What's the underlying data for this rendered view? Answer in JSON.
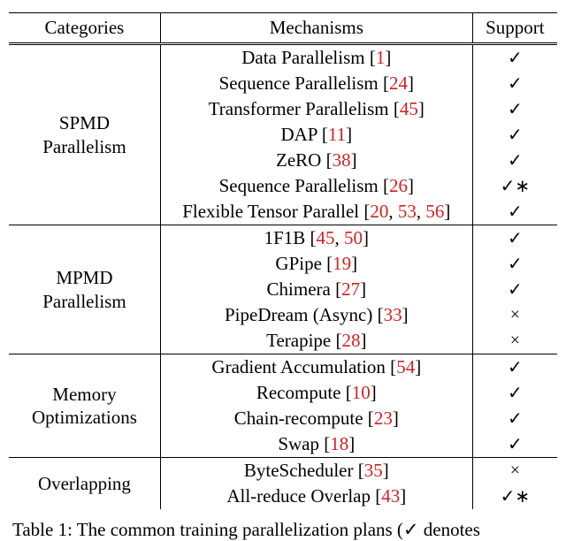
{
  "headers": {
    "c1": "Categories",
    "c2": "Mechanisms",
    "c3": "Support"
  },
  "categories": [
    {
      "name_l1": "SPMD",
      "name_l2": "Parallelism",
      "rows": 7
    },
    {
      "name_l1": "MPMD",
      "name_l2": "Parallelism",
      "rows": 5
    },
    {
      "name_l1": "Memory",
      "name_l2": "Optimizations",
      "rows": 4
    },
    {
      "name_l1": "Overlapping",
      "name_l2": "",
      "rows": 2
    }
  ],
  "rows": [
    {
      "cat": 0,
      "m": "Data Parallelism",
      "refs": [
        "1"
      ],
      "s": "✓"
    },
    {
      "cat": 0,
      "m": "Sequence Parallelism",
      "refs": [
        "24"
      ],
      "s": "✓"
    },
    {
      "cat": 0,
      "m": "Transformer Parallelism",
      "refs": [
        "45"
      ],
      "s": "✓"
    },
    {
      "cat": 0,
      "m": "DAP",
      "refs": [
        "11"
      ],
      "s": "✓"
    },
    {
      "cat": 0,
      "m": "ZeRO",
      "refs": [
        "38"
      ],
      "s": "✓"
    },
    {
      "cat": 0,
      "m": "Sequence Parallelism",
      "refs": [
        "26"
      ],
      "s": "✓∗"
    },
    {
      "cat": 0,
      "m": "Flexible Tensor Parallel",
      "refs": [
        "20",
        "53",
        "56"
      ],
      "s": "✓"
    },
    {
      "cat": 1,
      "m": "1F1B",
      "refs": [
        "45",
        "50"
      ],
      "s": "✓"
    },
    {
      "cat": 1,
      "m": "GPipe",
      "refs": [
        "19"
      ],
      "s": "✓"
    },
    {
      "cat": 1,
      "m": "Chimera",
      "refs": [
        "27"
      ],
      "s": "✓"
    },
    {
      "cat": 1,
      "m": "PipeDream (Async)",
      "refs": [
        "33"
      ],
      "s": "×"
    },
    {
      "cat": 1,
      "m": "Terapipe",
      "refs": [
        "28"
      ],
      "s": "×"
    },
    {
      "cat": 2,
      "m": "Gradient Accumulation",
      "refs": [
        "54"
      ],
      "s": "✓"
    },
    {
      "cat": 2,
      "m": "Recompute",
      "refs": [
        "10"
      ],
      "s": "✓"
    },
    {
      "cat": 2,
      "m": "Chain-recompute",
      "refs": [
        "23"
      ],
      "s": "✓"
    },
    {
      "cat": 2,
      "m": "Swap",
      "refs": [
        "18"
      ],
      "s": "✓"
    },
    {
      "cat": 3,
      "m": "ByteScheduler",
      "refs": [
        "35"
      ],
      "s": "×"
    },
    {
      "cat": 3,
      "m": "All-reduce Overlap",
      "refs": [
        "43"
      ],
      "s": "✓∗"
    }
  ],
  "caption_prefix": "Table 1: ",
  "caption_fragment": "The common training parallelization plans (✓ denotes"
}
